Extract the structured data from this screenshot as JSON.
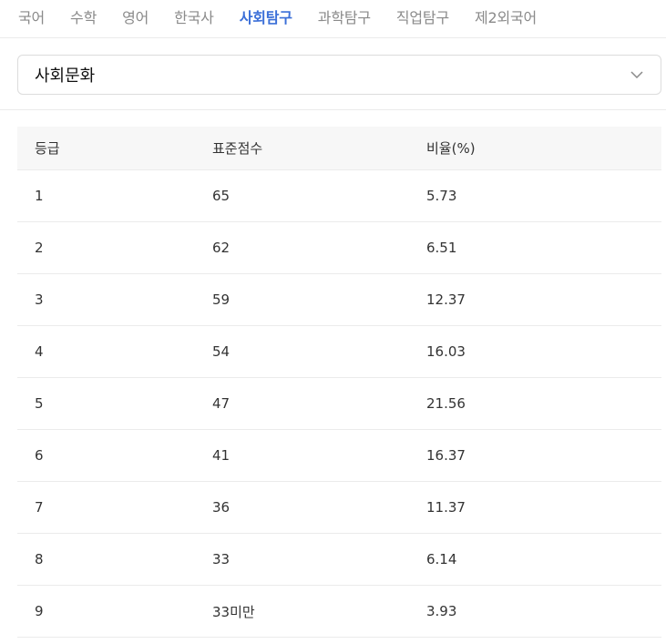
{
  "tabs": [
    "국어",
    "수학",
    "영어",
    "한국사",
    "사회탐구",
    "과학탐구",
    "직업탐구",
    "제2외국어"
  ],
  "active_tab": "사회탐구",
  "subject_select": {
    "value": "사회문화",
    "icon": "chevron-down-icon"
  },
  "table": {
    "headers": [
      "등급",
      "표준점수",
      "비율(%)"
    ],
    "rows": [
      [
        "1",
        "65",
        "5.73"
      ],
      [
        "2",
        "62",
        "6.51"
      ],
      [
        "3",
        "59",
        "12.37"
      ],
      [
        "4",
        "54",
        "16.03"
      ],
      [
        "5",
        "47",
        "21.56"
      ],
      [
        "6",
        "41",
        "16.37"
      ],
      [
        "7",
        "36",
        "11.37"
      ],
      [
        "8",
        "33",
        "6.14"
      ],
      [
        "9",
        "33미만",
        "3.93"
      ]
    ]
  },
  "colors": {
    "accent": "#3b6fd8",
    "tab_inactive": "#8a8a8a",
    "header_bg": "#f7f7f7",
    "divider": "#ebebeb"
  }
}
